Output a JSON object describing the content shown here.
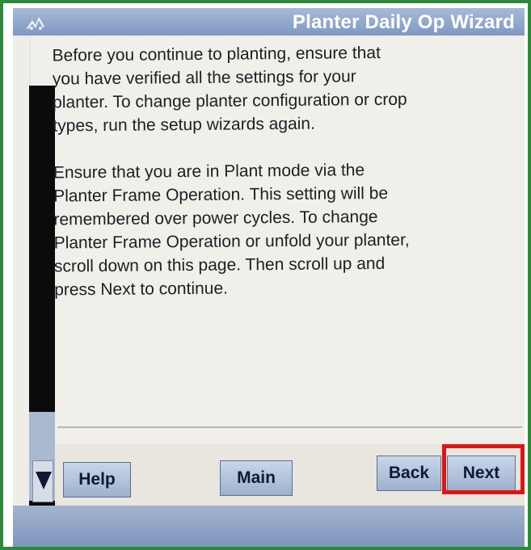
{
  "window": {
    "title": "Planter Daily Op Wizard",
    "icon": "wizard-tractor-icon"
  },
  "content": {
    "paragraphs": [
      "Before you continue to planting, ensure that\nyou have verified all the settings for your\nplanter. To change planter configuration or crop\ntypes, run the setup wizards again.",
      "Ensure that you are in Plant mode via the\nPlanter Frame Operation. This setting will be\nremembered over power cycles. To change\nPlanter Frame Operation or unfold your planter,\nscroll down on this page. Then scroll up and\npress Next to continue."
    ]
  },
  "buttons": {
    "help": "Help",
    "main": "Main",
    "back": "Back",
    "next": "Next"
  },
  "icons": {
    "scroll_down": "scroll-down-arrow-icon"
  },
  "colors": {
    "frame_border": "#2c8a3a",
    "title_bar": "#8ea5cc",
    "button": "#b4c5de",
    "highlight": "#e01414"
  }
}
